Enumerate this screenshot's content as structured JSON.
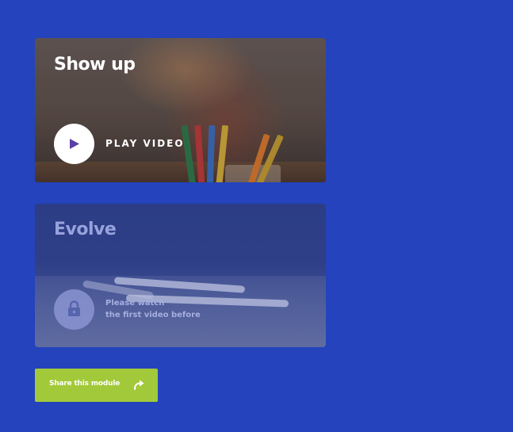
{
  "modules": [
    {
      "title": "Show up",
      "action_label": "PLAY VIDEO",
      "action_icon": "play-icon",
      "locked": false
    },
    {
      "title": "Evolve",
      "locked": true,
      "lock_icon": "lock-icon",
      "locked_message_line1": "Please watch",
      "locked_message_line2": "the first video before"
    }
  ],
  "share": {
    "label": "Share this module",
    "icon": "share-arrow-icon"
  },
  "colors": {
    "background": "#2443bc",
    "share_button": "#a2c93a",
    "play_icon": "#5a3fa8",
    "locked_circle": "#8792cf"
  }
}
